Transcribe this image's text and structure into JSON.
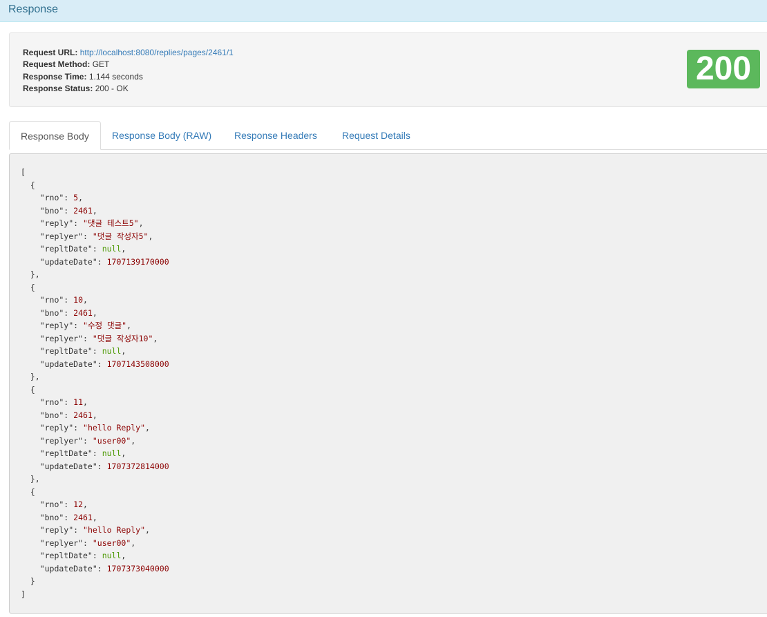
{
  "header": {
    "title": "Response"
  },
  "summary": {
    "request_url_label": "Request URL:",
    "request_url": "http://localhost:8080/replies/pages/2461/1",
    "request_method_label": "Request Method:",
    "request_method": "GET",
    "response_time_label": "Response Time:",
    "response_time": "1.144 seconds",
    "response_status_label": "Response Status:",
    "response_status": "200 - OK",
    "status_code": "200",
    "status_color": "#5cb85c"
  },
  "tabs": [
    {
      "label": "Response Body",
      "active": true
    },
    {
      "label": "Response Body (RAW)",
      "active": false
    },
    {
      "label": "Response Headers",
      "active": false
    },
    {
      "label": "Request Details",
      "active": false
    }
  ],
  "body": {
    "replies": [
      {
        "rno": "5",
        "bno": "2461",
        "reply": "\"댓글 테스트5\"",
        "replyer": "\"댓글 작성자5\"",
        "repltDate": "null",
        "updateDate": "1707139170000"
      },
      {
        "rno": "10",
        "bno": "2461",
        "reply": "\"수정 댓글\"",
        "replyer": "\"댓글 작성자10\"",
        "repltDate": "null",
        "updateDate": "1707143508000"
      },
      {
        "rno": "11",
        "bno": "2461",
        "reply": "\"hello Reply\"",
        "replyer": "\"user00\"",
        "repltDate": "null",
        "updateDate": "1707372814000"
      },
      {
        "rno": "12",
        "bno": "2461",
        "reply": "\"hello Reply\"",
        "replyer": "\"user00\"",
        "repltDate": "null",
        "updateDate": "1707373040000"
      }
    ]
  }
}
